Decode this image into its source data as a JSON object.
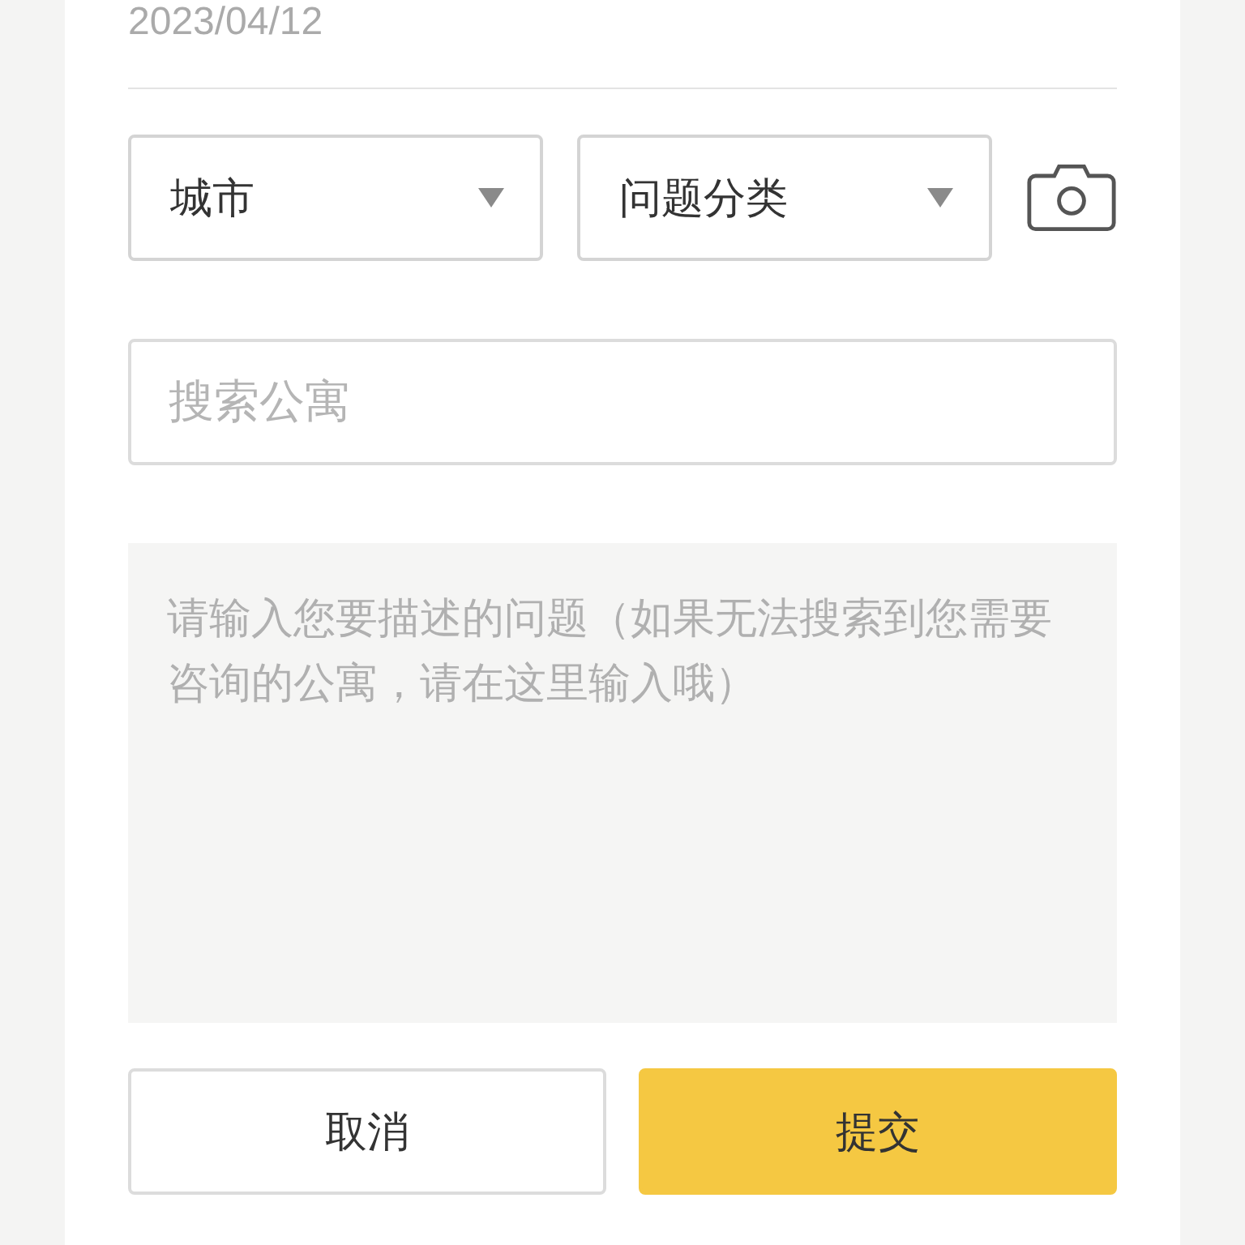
{
  "date": "2023/04/12",
  "selects": [
    {
      "label": "城市"
    },
    {
      "label": "问题分类"
    }
  ],
  "search": {
    "placeholder": "搜索公寓"
  },
  "description": {
    "placeholder": "请输入您要描述的问题（如果无法搜索到您需要咨询的公寓，请在这里输入哦）"
  },
  "buttons": [
    {
      "label": "取消",
      "kind": "secondary"
    },
    {
      "label": "提交",
      "kind": "primary"
    }
  ]
}
